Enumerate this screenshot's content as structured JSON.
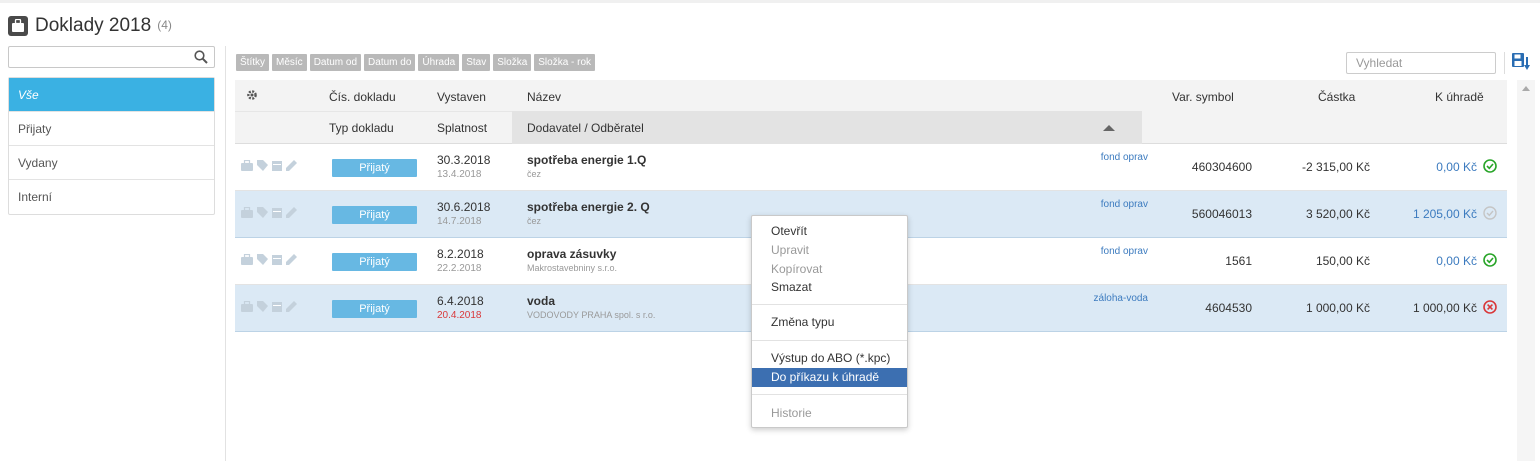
{
  "page": {
    "title": "Doklady 2018",
    "count": "(4)"
  },
  "sidebar": {
    "search_placeholder": "",
    "items": [
      {
        "label": "Vše"
      },
      {
        "label": "Přijaty"
      },
      {
        "label": "Vydany"
      },
      {
        "label": "Interní"
      }
    ]
  },
  "filters": {
    "chips": [
      "Štítky",
      "Měsíc",
      "Datum od",
      "Datum do",
      "Úhrada",
      "Stav",
      "Složka",
      "Složka - rok"
    ],
    "search_placeholder": "Vyhledat"
  },
  "table": {
    "headers": {
      "cis": "Čís. dokladu",
      "typ": "Typ dokladu",
      "vystaven": "Vystaven",
      "splatnost": "Splatnost",
      "nazev": "Název",
      "dodavatel": "Dodavatel / Odběratel",
      "var": "Var. symbol",
      "castka": "Částka",
      "kuhrade": "K úhradě"
    },
    "rows": [
      {
        "type": "Přijatý",
        "date": "30.3.2018",
        "due_date": "13.4.2018",
        "name": "spotřeba energie 1.Q",
        "partner": "čez",
        "tag": "fond oprav",
        "var": "460304600",
        "amount": "-2 315,00 Kč",
        "to_pay": "0,00 Kč",
        "status": "paid-icon"
      },
      {
        "type": "Přijatý",
        "date": "30.6.2018",
        "due_date": "14.7.2018",
        "name": "spotřeba energie 2. Q",
        "partner": "čez",
        "tag": "fond oprav",
        "var": "560046013",
        "amount": "3 520,00 Kč",
        "to_pay": "1 205,00 Kč",
        "status": "partial-icon"
      },
      {
        "type": "Přijatý",
        "date": "8.2.2018",
        "due_date": "22.2.2018",
        "name": "oprava zásuvky",
        "partner": "Makrostavebniny s.r.o.",
        "tag": "fond oprav",
        "var": "1561",
        "amount": "150,00 Kč",
        "to_pay": "0,00 Kč",
        "status": "paid-icon"
      },
      {
        "type": "Přijatý",
        "date": "6.4.2018",
        "due_date": "20.4.2018",
        "name": "voda",
        "partner": "VODOVODY PRAHA spol. s r.o.",
        "tag": "záloha-voda",
        "var": "4604530",
        "amount": "1 000,00 Kč",
        "to_pay": "1 000,00 Kč",
        "status": "unpaid-icon"
      }
    ]
  },
  "context_menu": {
    "items": [
      {
        "label": "Otevřít"
      },
      {
        "label": "Upravit"
      },
      {
        "label": "Kopírovat"
      },
      {
        "label": "Smazat"
      },
      {
        "label": "Změna typu"
      },
      {
        "label": "Výstup do ABO (*.kpc)"
      },
      {
        "label": "Do příkazu k úhradě"
      },
      {
        "label": "Historie"
      }
    ]
  },
  "colors": {
    "accent": "#3ab1e3",
    "badge": "#67b8e3",
    "selected_row": "#dbe9f5",
    "menu_highlight": "#3c6fb1",
    "ok": "#2aa52a",
    "error": "#d9383a"
  }
}
